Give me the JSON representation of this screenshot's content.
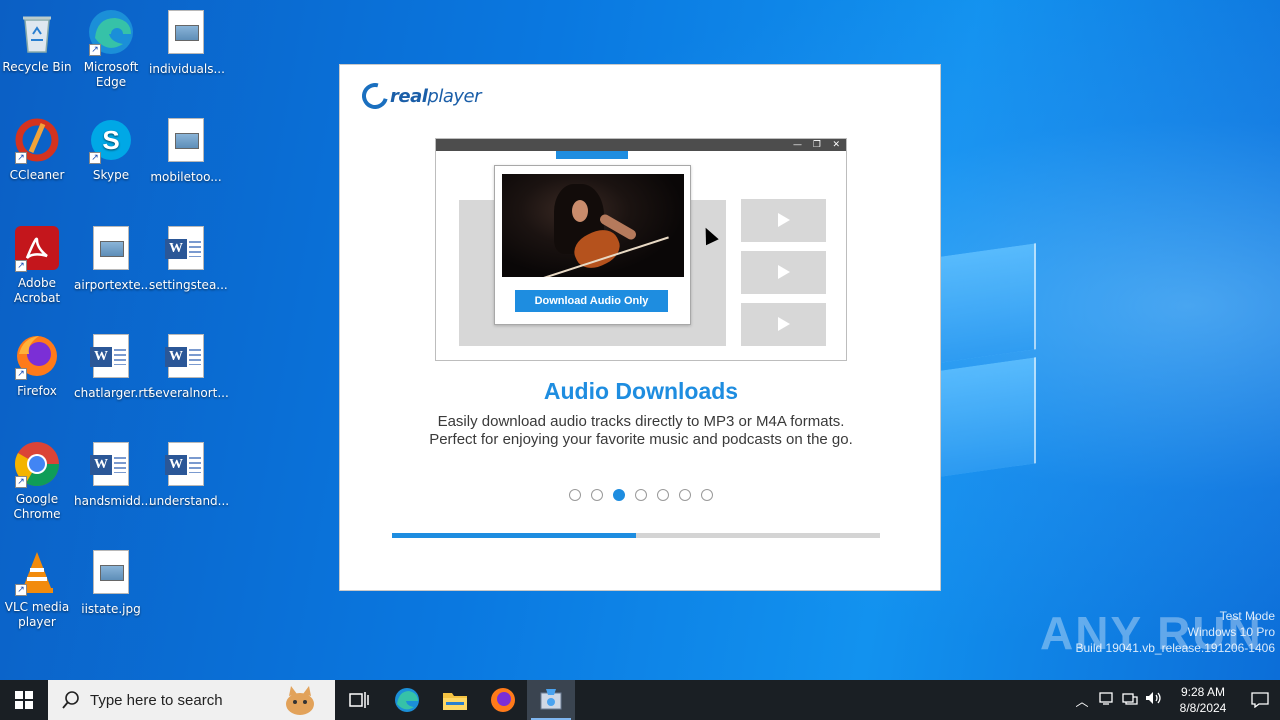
{
  "desktop": {
    "icons": [
      {
        "label": "Recycle Bin",
        "icon": "recycle-bin-icon"
      },
      {
        "label": "Microsoft Edge",
        "icon": "edge-icon"
      },
      {
        "label": "individuals...",
        "icon": "image-file-icon"
      },
      {
        "label": "CCleaner",
        "icon": "ccleaner-icon"
      },
      {
        "label": "Skype",
        "icon": "skype-icon"
      },
      {
        "label": "mobiletoo...",
        "icon": "image-file-icon"
      },
      {
        "label": "Adobe Acrobat",
        "icon": "acrobat-icon"
      },
      {
        "label": "airportexte...",
        "icon": "image-file-icon"
      },
      {
        "label": "settingstea...",
        "icon": "word-file-icon"
      },
      {
        "label": "Firefox",
        "icon": "firefox-icon"
      },
      {
        "label": "chatlarger.rtf",
        "icon": "word-file-icon"
      },
      {
        "label": "severalnort...",
        "icon": "word-file-icon"
      },
      {
        "label": "Google Chrome",
        "icon": "chrome-icon"
      },
      {
        "label": "handsmidd...",
        "icon": "word-file-icon"
      },
      {
        "label": "understand...",
        "icon": "word-file-icon"
      },
      {
        "label": "VLC media player",
        "icon": "vlc-icon"
      },
      {
        "label": "iistate.jpg",
        "icon": "image-file-icon"
      }
    ]
  },
  "dialog": {
    "logo_bold": "real",
    "logo_rest": "player",
    "mock": {
      "button_label": "Download Audio Only"
    },
    "heading": "Audio Downloads",
    "description_line1": "Easily download audio tracks directly to MP3 or M4A formats.",
    "description_line2": "Perfect for enjoying your favorite music and podcasts on the go.",
    "carousel_total": 7,
    "carousel_active": 3,
    "progress_fraction": 0.5,
    "accent_color": "#1e8de0"
  },
  "watermark": {
    "brand": "ANY RUN",
    "line1": "Test Mode",
    "line2": "Windows 10 Pro",
    "line3": "Build 19041.vb_release.191206-1406"
  },
  "taskbar": {
    "search_placeholder": "Type here to search",
    "apps": [
      "task-view-icon",
      "edge-icon",
      "file-explorer-icon",
      "firefox-icon",
      "installer-icon"
    ],
    "time": "9:28 AM",
    "date": "8/8/2024"
  }
}
